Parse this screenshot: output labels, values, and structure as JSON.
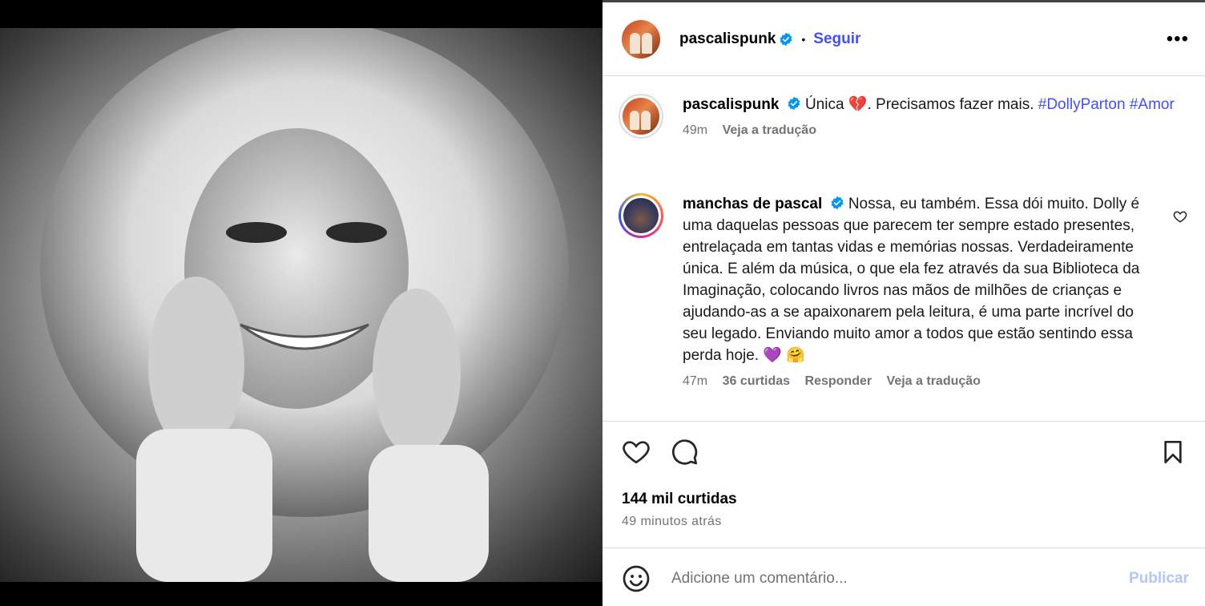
{
  "post": {
    "image_alt": "Black and white portrait photo",
    "author": "pascalispunk",
    "follow_label": "Seguir",
    "more_label": "•••"
  },
  "caption": {
    "username": "pascalispunk",
    "text_before": "Única",
    "emoji": "💔",
    "text_after": ". Precisamos fazer mais.",
    "hashtag1": "#DollyParton",
    "hashtag2": "#Amor",
    "time": "49m",
    "translate": "Veja a tradução"
  },
  "comment": {
    "username": "manchas de pascal",
    "text": "Nossa, eu também. Essa dói muito. Dolly é uma daquelas pessoas que parecem ter sempre estado presentes, entrelaçada em tantas vidas e memórias nossas. Verdadeiramente única. E além da música, o que ela fez através da sua Biblioteca da Imaginação, colocando livros nas mãos de milhões de crianças e ajudando-as a se apaixonarem pela leitura, é uma parte incrível do seu legado. Enviando muito amor a todos que estão sentindo essa perda hoje. 💜 🤗",
    "time": "47m",
    "likes": "36 curtidas",
    "reply": "Responder",
    "translate": "Veja a tradução"
  },
  "stats": {
    "likes": "144 mil curtidas",
    "time": "49 minutos atrás"
  },
  "composer": {
    "placeholder": "Adicione um comentário...",
    "publish": "Publicar"
  },
  "colors": {
    "accent": "#4150f7",
    "muted": "#737373",
    "publish_disabled": "#b3c5ff",
    "verified": "#0095f6"
  }
}
